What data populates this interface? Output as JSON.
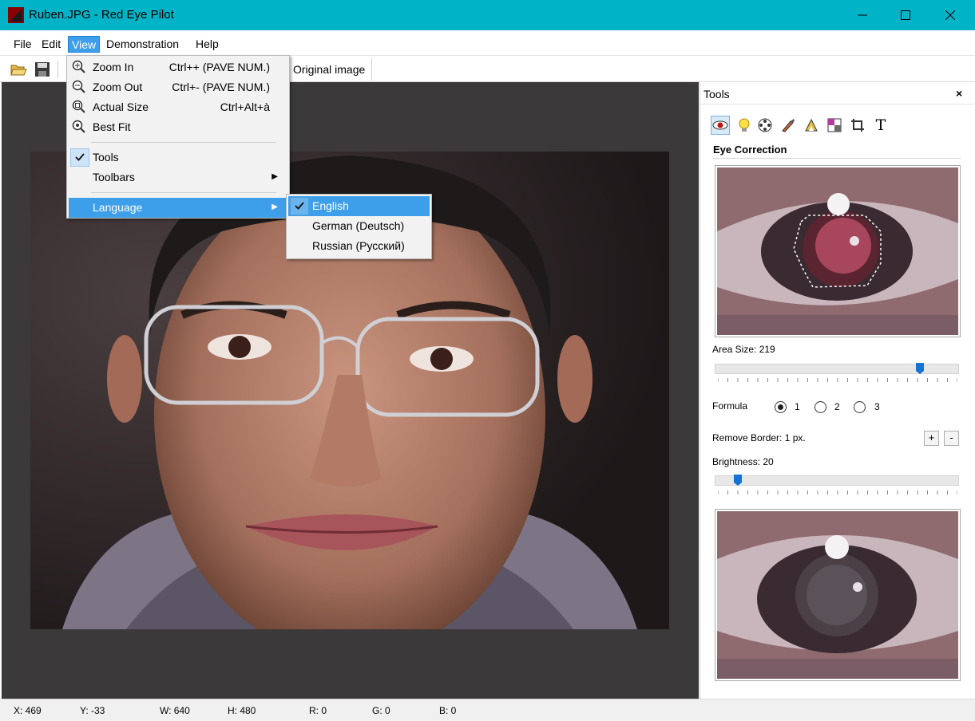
{
  "window": {
    "title": "Ruben.JPG - Red Eye Pilot",
    "controls": {
      "minimize": "minimize-icon",
      "maximize": "maximize-icon",
      "close": "close-icon"
    }
  },
  "menubar": {
    "items": [
      "File",
      "Edit",
      "View",
      "Demonstration",
      "Help"
    ],
    "active": "View"
  },
  "toolbar": {
    "icons": [
      "open-folder-icon",
      "save-disk-icon"
    ],
    "original_image_label": "Original image"
  },
  "view_menu": {
    "items": [
      {
        "label": "Zoom In",
        "shortcut": "Ctrl++ (PAVE NUM.)",
        "icon": "zoom-in-icon"
      },
      {
        "label": "Zoom Out",
        "shortcut": "Ctrl+- (PAVE NUM.)",
        "icon": "zoom-out-icon"
      },
      {
        "label": "Actual Size",
        "shortcut": "Ctrl+Alt+à",
        "icon": "actual-size-icon"
      },
      {
        "label": "Best Fit",
        "shortcut": "",
        "icon": "best-fit-icon"
      },
      {
        "label": "Tools",
        "checked": true
      },
      {
        "label": "Toolbars",
        "submenu": true
      },
      {
        "label": "Language",
        "submenu": true,
        "highlighted": true
      }
    ]
  },
  "language_menu": {
    "items": [
      {
        "label": "English",
        "checked": true,
        "highlighted": true
      },
      {
        "label": "German (Deutsch)"
      },
      {
        "label": "Russian (Русский)"
      }
    ]
  },
  "tools_panel": {
    "title": "Tools",
    "close": "×",
    "tool_icons": [
      "eye-correction-icon",
      "lightbulb-icon",
      "film-reel-icon",
      "brush-icon",
      "triangle-ruler-icon",
      "color-square-icon",
      "crop-icon",
      "text-tool-icon"
    ],
    "text_tool_glyph": "T",
    "section_title": "Eye Correction",
    "area_size": {
      "label": "Area Size: 219",
      "value": 219,
      "fraction": 0.85
    },
    "formula": {
      "label": "Formula",
      "options": [
        "1",
        "2",
        "3"
      ],
      "selected": "1"
    },
    "remove_border": {
      "label": "Remove Border: 1 px.",
      "plus": "+",
      "minus": "-"
    },
    "brightness": {
      "label": "Brightness: 20",
      "value": 20,
      "fraction": 0.08
    }
  },
  "statusbar": {
    "x": "X: 469",
    "y": "Y: -33",
    "w": "W: 640",
    "h": "H: 480",
    "r": "R: 0",
    "g": "G: 0",
    "b": "B: 0"
  },
  "colors": {
    "titlebar": "#00b3c7",
    "highlight": "#3d9eea",
    "canvas_bg": "#3c393a"
  }
}
